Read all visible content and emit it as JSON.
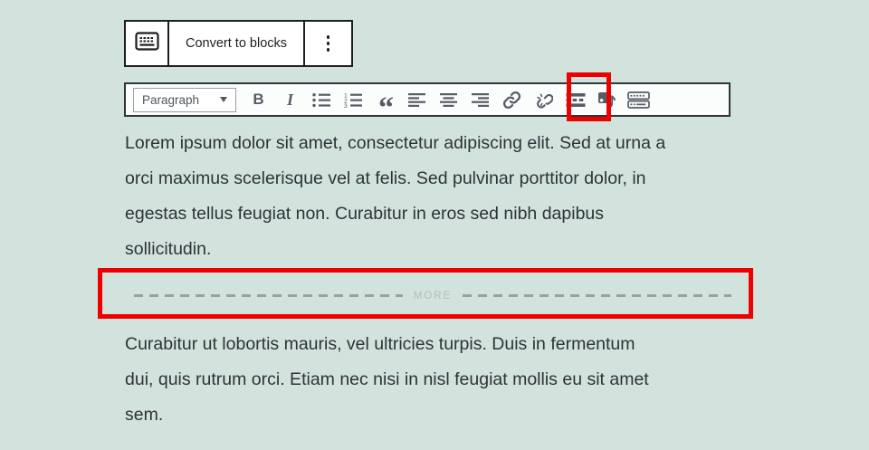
{
  "theme": {
    "background_color": "#d2e3dd",
    "highlight_color": "#ee0000",
    "toolbar_icon_color": "#555d66",
    "body_text_color": "#2e3338"
  },
  "classic_toolbar": {
    "convert_button_label": "Convert to blocks",
    "icons": [
      "keyboard-icon",
      "vertical-ellipsis-icon"
    ]
  },
  "format_toolbar": {
    "block_type_selected": "Paragraph",
    "bold_label": "B",
    "italic_label": "I",
    "blockquote_label": "“",
    "buttons": [
      "paragraph-dropdown",
      "bold",
      "italic",
      "bulleted-list",
      "numbered-list",
      "blockquote",
      "align-left",
      "align-center",
      "align-right",
      "link",
      "unlink",
      "more-tag",
      "add-media",
      "toolbar-toggle"
    ]
  },
  "content": {
    "paragraph_1_lines": [
      "Lorem ipsum dolor sit amet, consectetur adipiscing elit. Sed at urna a",
      "orci maximus scelerisque vel at felis. Sed pulvinar porttitor dolor, in",
      "egestas tellus feugiat non. Curabitur in eros sed nibh dapibus",
      "sollicitudin."
    ],
    "more_divider_label": "MORE",
    "paragraph_2_lines": [
      "Curabitur ut lobortis mauris, vel ultricies turpis. Duis in fermentum",
      "dui, quis rutrum orci. Etiam nec nisi in nisl feugiat mollis eu sit amet",
      "sem."
    ]
  }
}
